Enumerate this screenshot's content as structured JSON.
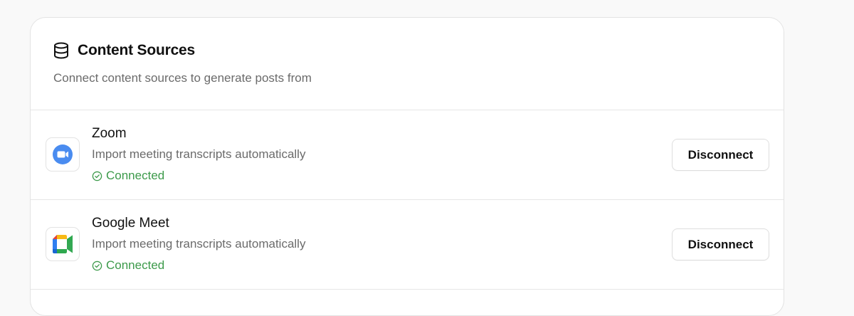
{
  "card": {
    "title": "Content Sources",
    "subtitle": "Connect content sources to generate posts from",
    "icon": "database-icon"
  },
  "sources": [
    {
      "name": "Zoom",
      "description": "Import meeting transcripts automatically",
      "status": "Connected",
      "action_label": "Disconnect",
      "icon": "zoom-logo-icon"
    },
    {
      "name": "Google Meet",
      "description": "Import meeting transcripts automatically",
      "status": "Connected",
      "action_label": "Disconnect",
      "icon": "google-meet-logo-icon"
    }
  ],
  "colors": {
    "connected": "#3c9a4a",
    "zoom_blue": "#4a8cf0"
  }
}
